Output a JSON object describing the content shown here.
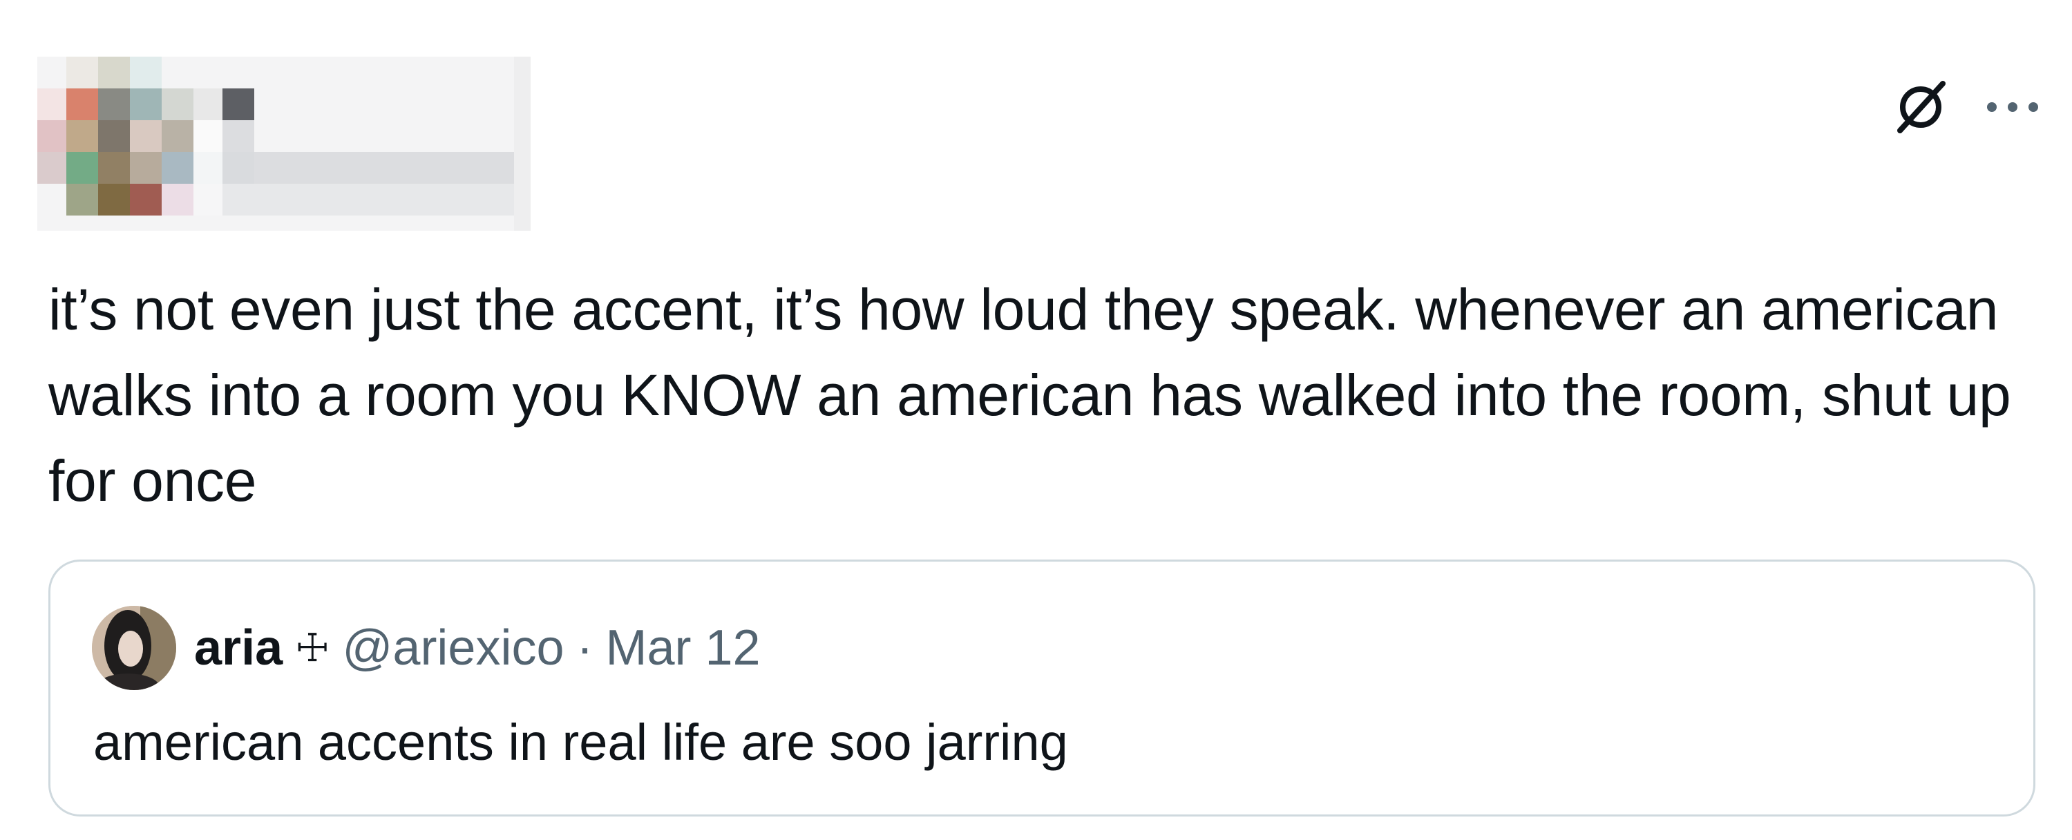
{
  "post": {
    "text": "it’s not even just the accent, it’s how loud they speak. whenever an american walks into a room you KNOW an american has walked into the room, shut up for once",
    "actions": {
      "grok_icon": "slashed-circle-icon",
      "more_icon": "more-horizontal-icon"
    }
  },
  "quote": {
    "name": "aria",
    "symbol": "☩",
    "handle": "@ariexico",
    "separator": "·",
    "date": "Mar 12",
    "text": "american accents in real life are soo jarring"
  },
  "colors": {
    "text": "#0f1419",
    "secondary": "#536471",
    "border": "#cfd9de"
  }
}
